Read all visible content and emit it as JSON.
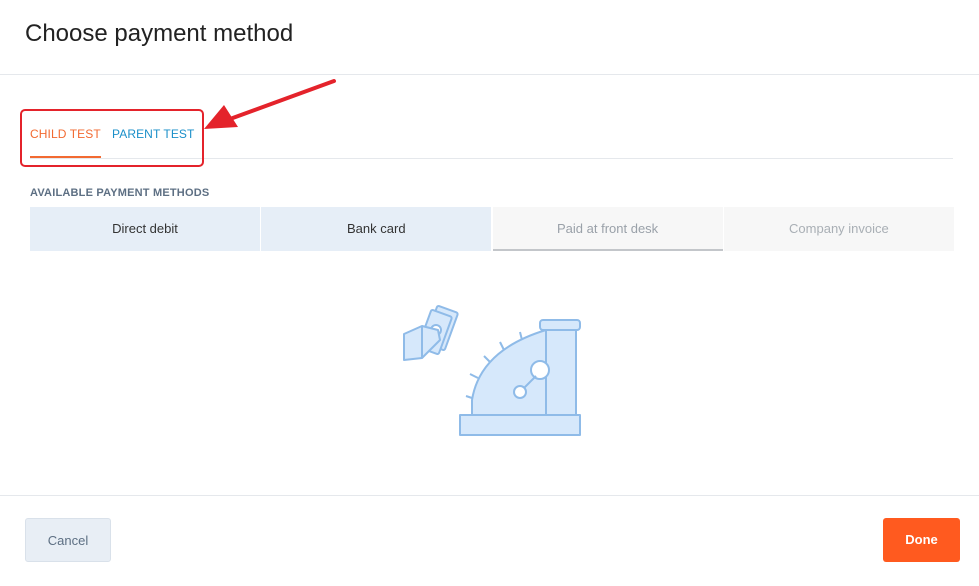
{
  "dialog": {
    "title": "Choose payment method"
  },
  "tabs": [
    {
      "label": "CHILD TEST",
      "active": true
    },
    {
      "label": "PARENT TEST",
      "active": false
    }
  ],
  "payment": {
    "section_label": "AVAILABLE PAYMENT METHODS",
    "methods": [
      {
        "label": "Direct debit",
        "state": "enabled"
      },
      {
        "label": "Bank card",
        "state": "enabled"
      },
      {
        "label": "Paid at front desk",
        "state": "selected"
      },
      {
        "label": "Company invoice",
        "state": "disabled"
      }
    ],
    "illustration_icon": "cash-register-icon"
  },
  "annotation": {
    "color": "#e4232b",
    "icon": "arrow-icon"
  },
  "footer": {
    "cancel_label": "Cancel",
    "done_label": "Done"
  },
  "colors": {
    "accent": "#f26a31",
    "link": "#1a8fc9",
    "done_button": "#ff5a1f",
    "method_bg": "#e6eef7"
  }
}
